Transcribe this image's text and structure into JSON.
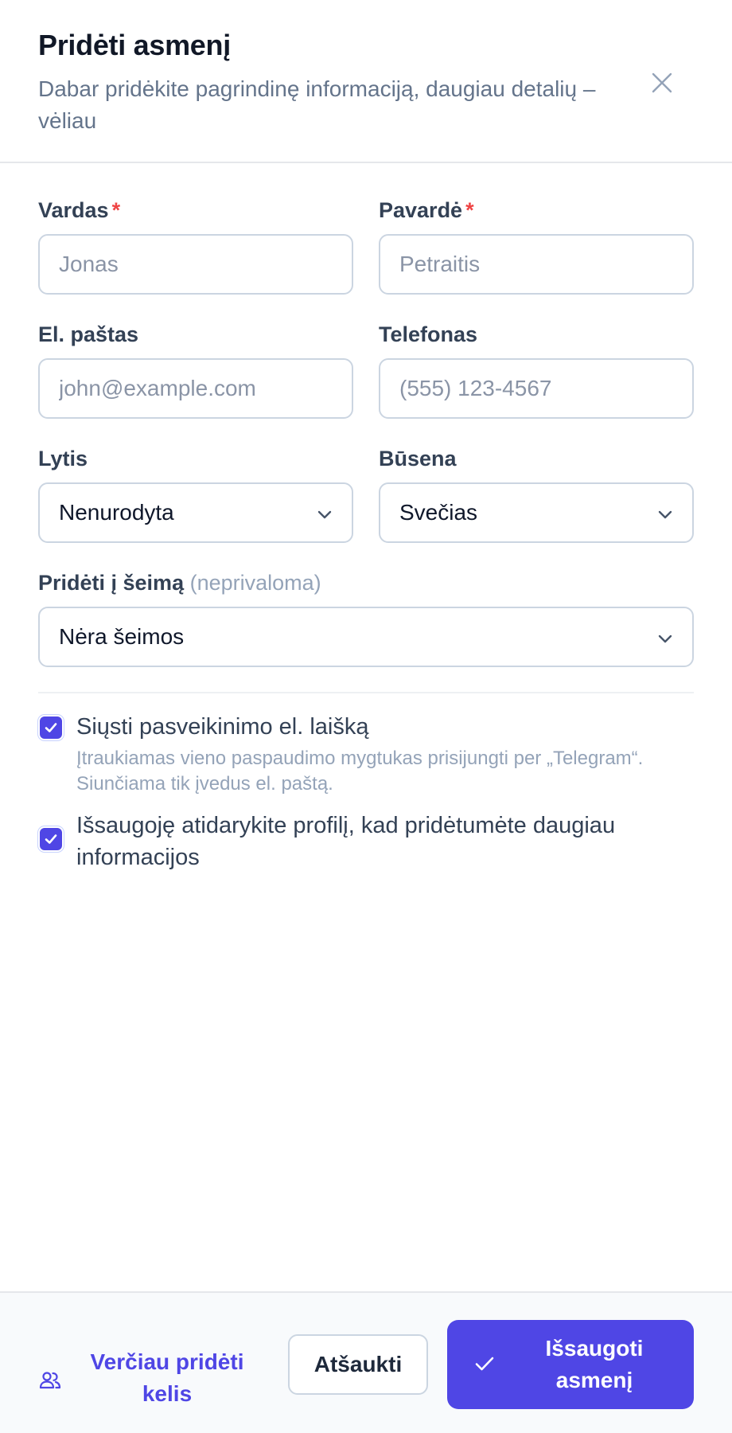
{
  "dialog": {
    "title": "Pridėti asmenį",
    "subtitle": "Dabar pridėkite pagrindinę informaciją, daugiau detalių – vėliau"
  },
  "form": {
    "first_name": {
      "label": "Vardas",
      "required_mark": "*",
      "placeholder": "Jonas",
      "value": ""
    },
    "last_name": {
      "label": "Pavardė",
      "required_mark": "*",
      "placeholder": "Petraitis",
      "value": ""
    },
    "email": {
      "label": "El. paštas",
      "placeholder": "john@example.com",
      "value": ""
    },
    "phone": {
      "label": "Telefonas",
      "placeholder": "(555) 123-4567",
      "value": ""
    },
    "gender": {
      "label": "Lytis",
      "selected": "Nenurodyta"
    },
    "status": {
      "label": "Būsena",
      "selected": "Svečias"
    },
    "family": {
      "label": "Pridėti į šeimą",
      "optional_hint": "(neprivaloma)",
      "selected": "Nėra šeimos"
    }
  },
  "options": {
    "welcome_email": {
      "checked": true,
      "label": "Siųsti pasveikinimo el. laišką",
      "help_line1": "Įtraukiamas vieno paspaudimo mygtukas prisijungti per „Telegram“.",
      "help_line2": "Siunčiama tik įvedus el. paštą."
    },
    "open_profile": {
      "checked": true,
      "label_line1": "Išsaugoję atidarykite profilį, kad pridėtumėte daugiau",
      "label_line2": "informacijos"
    }
  },
  "footer": {
    "add_multiple_line1": "Verčiau pridėti",
    "add_multiple_line2": "kelis",
    "cancel": "Atšaukti",
    "save_line1": "Išsaugoti",
    "save_line2": "asmenį"
  },
  "colors": {
    "accent": "#4f46e5",
    "required": "#ef4444",
    "muted": "#94a3b8"
  },
  "icons": {
    "close": "close-icon",
    "chevron": "chevron-down-icon",
    "checkbox": "check-icon",
    "users": "users-icon",
    "save_check": "check-icon"
  }
}
